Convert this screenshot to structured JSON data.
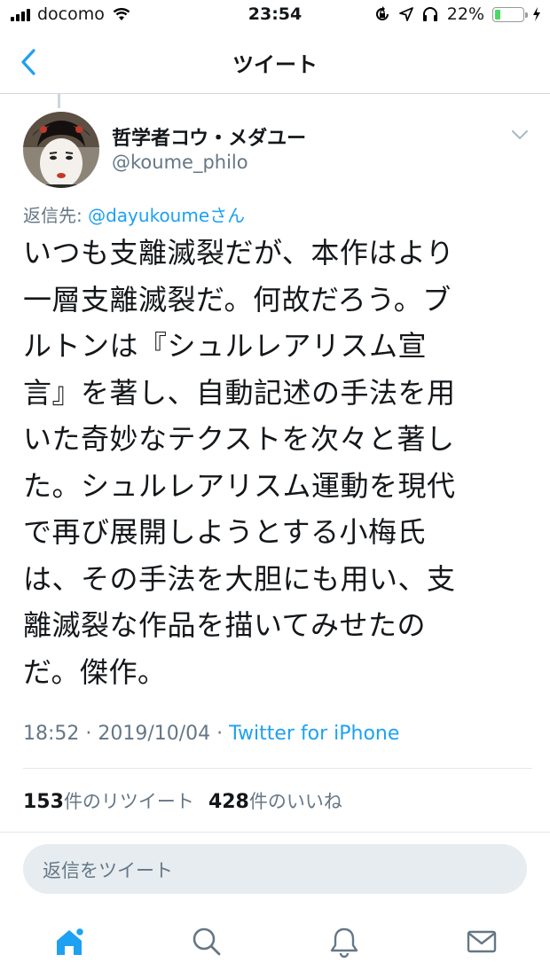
{
  "status_bar": {
    "carrier": "docomo",
    "time": "23:54",
    "battery": "22%",
    "battery_level": 0.22
  },
  "nav": {
    "title": "ツイート",
    "back_icon": "chevron-left-icon"
  },
  "tweet": {
    "name": "哲学者コウ・メダユー",
    "handle": "@koume_philo",
    "reply_prefix": "返信先: ",
    "reply_mention": "@dayukoume",
    "reply_suffix": "さん",
    "text": "いつも支離滅裂だが、本作はより\n一層支離滅裂だ。何故だろう。ブ\nルトンは『シュルレアリスム宣\n言』を著し、自動記述の手法を用\nいた奇妙なテクストを次々と著し\nた。シュルレアリスム運動を現代\nで再び展開しようとする小梅氏\nは、その手法を大胆にも用い、支\n離滅裂な作品を描いてみせたの\nだ。傑作。",
    "timestamp": "18:52 · 2019/10/04 · ",
    "source": "Twitter for iPhone"
  },
  "stats": {
    "retweets_count": "153",
    "retweets_label": "件のリツイート",
    "likes_count": "428",
    "likes_label": "件のいいね"
  },
  "reply": {
    "placeholder": "返信をツイート"
  },
  "tabs": [
    {
      "icon": "home-icon",
      "active": true
    },
    {
      "icon": "search-icon",
      "active": false
    },
    {
      "icon": "bell-icon",
      "active": false
    },
    {
      "icon": "mail-icon",
      "active": false
    }
  ],
  "colors": {
    "accent": "#1da1f2",
    "secondary_text": "#657786",
    "battery_fill": "#4cd964"
  }
}
